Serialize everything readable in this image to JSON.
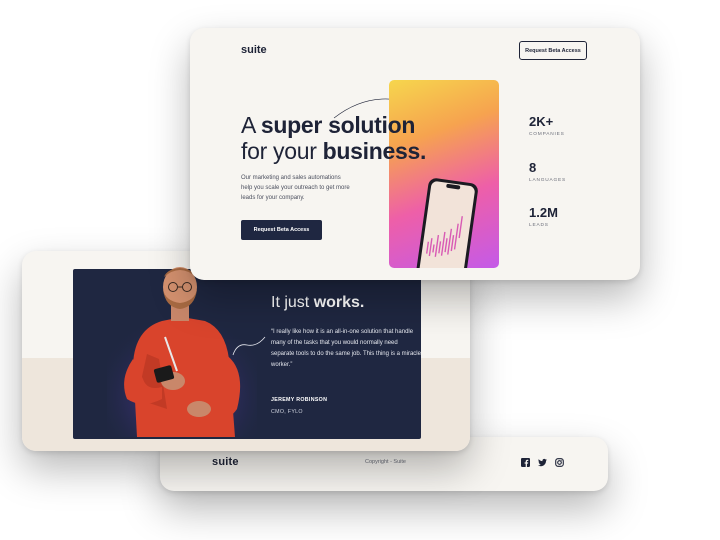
{
  "hero": {
    "logo": "suite",
    "nav_cta": "Request Beta Access",
    "headline_line1_pre": "A ",
    "headline_line1_bold": "super solution",
    "headline_line2_pre": "for your ",
    "headline_line2_bold": "business.",
    "subtext": "Our marketing and sales automations help you scale your outreach to get more leads for your company.",
    "cta": "Request Beta Access",
    "stats": [
      {
        "value": "2K+",
        "label": "COMPANIES"
      },
      {
        "value": "8",
        "label": "LANGUAGES"
      },
      {
        "value": "1.2M",
        "label": "LEADS"
      }
    ]
  },
  "testimonial": {
    "title_pre": "It just ",
    "title_bold": "works.",
    "quote": "“I really like how it is an all-in-one solution that handle many of the tasks that you would normally need separate tools to do the same job. This thing is a miracle worker.”",
    "name": "JEREMY ROBINSON",
    "role": "CMO, FYLO"
  },
  "footer": {
    "logo": "suite",
    "copyright": "Copyright - Suite",
    "social_icons": [
      "facebook-icon",
      "twitter-icon",
      "instagram-icon"
    ]
  },
  "colors": {
    "navy": "#1f2741",
    "cream": "#f7f5f1",
    "band": "#eee6dc",
    "gradient": [
      "#f6d64d",
      "#ee5fa8",
      "#c45ae8"
    ]
  }
}
